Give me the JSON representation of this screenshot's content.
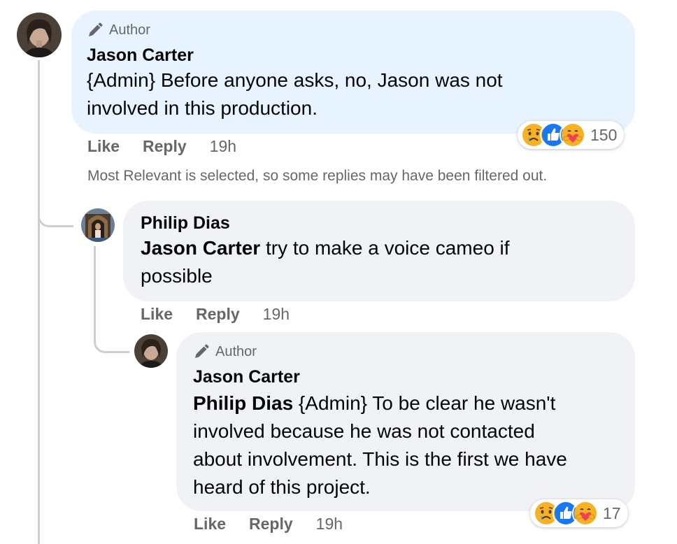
{
  "comments": [
    {
      "author_tag": "Author",
      "name": "Jason Carter",
      "text_line1": "{Admin} Before anyone asks, no, Jason was not",
      "text_line2": "involved in this production.",
      "actions": {
        "like": "Like",
        "reply": "Reply",
        "time": "19h"
      },
      "reaction_count": "150"
    },
    {
      "name": "Philip Dias",
      "mention": "Jason Carter",
      "text_rest": " try to make a voice cameo if",
      "text_line2": "possible",
      "actions": {
        "like": "Like",
        "reply": "Reply",
        "time": "19h"
      }
    },
    {
      "author_tag": "Author",
      "name": "Jason Carter",
      "mention": "Philip Dias",
      "text_rest": " {Admin} To be clear he wasn't",
      "text_line2": "involved because he was not contacted",
      "text_line3": "about involvement. This is the first we have",
      "text_line4": "heard of this project.",
      "actions": {
        "like": "Like",
        "reply": "Reply",
        "time": "19h"
      },
      "reaction_count": "17"
    }
  ],
  "filter_note": "Most Relevant is selected, so some replies may have been filtered out.",
  "reactions": [
    "sad-icon",
    "like-icon",
    "care-icon"
  ],
  "colors": {
    "blue_bubble": "#e7f3ff",
    "grey_bubble": "#f0f2f5",
    "like_blue": "#1877f2",
    "secondary_text": "#65676b"
  }
}
